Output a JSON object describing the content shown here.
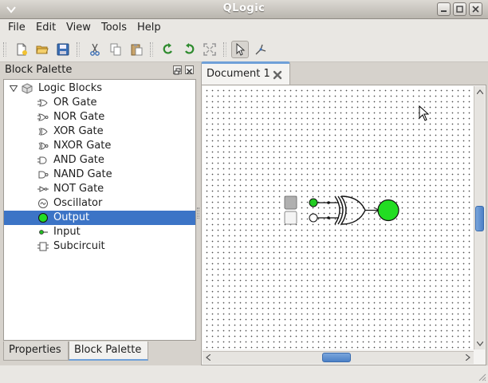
{
  "window": {
    "title": "QLogic"
  },
  "menubar": {
    "items": [
      "File",
      "Edit",
      "View",
      "Tools",
      "Help"
    ]
  },
  "toolbar": {
    "buttons": [
      {
        "name": "new-document",
        "icon": "new-document-icon"
      },
      {
        "name": "open",
        "icon": "open-folder-icon"
      },
      {
        "name": "save",
        "icon": "save-icon"
      },
      {
        "name": "cut",
        "icon": "cut-icon"
      },
      {
        "name": "copy",
        "icon": "copy-icon"
      },
      {
        "name": "paste",
        "icon": "paste-icon"
      },
      {
        "name": "rotate-left",
        "icon": "rotate-left-icon"
      },
      {
        "name": "rotate-right",
        "icon": "rotate-right-icon"
      },
      {
        "name": "fit",
        "icon": "fit-view-icon"
      },
      {
        "name": "select-tool",
        "icon": "pointer-icon",
        "active": true
      },
      {
        "name": "wire-tool",
        "icon": "wire-tool-icon"
      }
    ]
  },
  "palette": {
    "title": "Block Palette",
    "root_label": "Logic Blocks",
    "items": [
      {
        "label": "OR Gate",
        "icon": "or-gate-icon"
      },
      {
        "label": "NOR Gate",
        "icon": "nor-gate-icon"
      },
      {
        "label": "XOR Gate",
        "icon": "xor-gate-icon"
      },
      {
        "label": "NXOR Gate",
        "icon": "nxor-gate-icon"
      },
      {
        "label": "AND Gate",
        "icon": "and-gate-icon"
      },
      {
        "label": "NAND Gate",
        "icon": "nand-gate-icon"
      },
      {
        "label": "NOT Gate",
        "icon": "not-gate-icon"
      },
      {
        "label": "Oscillator",
        "icon": "oscillator-icon"
      },
      {
        "label": "Output",
        "icon": "output-icon",
        "selected": true
      },
      {
        "label": "Input",
        "icon": "input-icon"
      },
      {
        "label": "Subcircuit",
        "icon": "subcircuit-icon"
      }
    ]
  },
  "bottom_tabs": {
    "properties": "Properties",
    "palette": "Block Palette"
  },
  "document": {
    "tab_label": "Document 1"
  },
  "colors": {
    "selection": "#3c74c6",
    "output_on": "#22dd22",
    "accent_tab": "#6fa0d8"
  }
}
